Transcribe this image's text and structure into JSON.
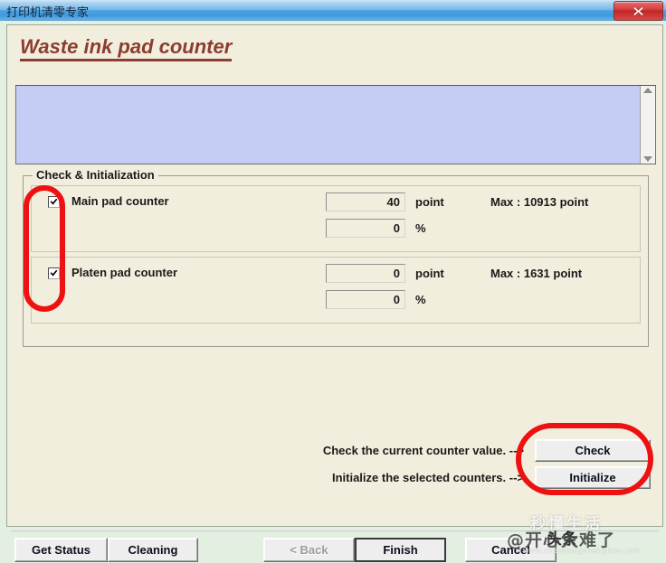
{
  "window": {
    "title": "打印机清零专家",
    "close_icon": "close-x-icon"
  },
  "page": {
    "heading": "Waste ink pad counter",
    "log_text": ""
  },
  "group": {
    "legend": "Check & Initialization",
    "rows": [
      {
        "label": "Main pad counter",
        "checked": true,
        "point_value": "40",
        "point_unit": "point",
        "percent_value": "0",
        "percent_unit": "%",
        "max_label": "Max : 10913 point"
      },
      {
        "label": "Platen pad counter",
        "checked": true,
        "point_value": "0",
        "point_unit": "point",
        "percent_value": "0",
        "percent_unit": "%",
        "max_label": "Max : 1631 point"
      }
    ]
  },
  "actions": [
    {
      "text": "Check the current counter value. -->",
      "button": "Check"
    },
    {
      "text": "Initialize the selected counters. -->",
      "button": "Initialize"
    }
  ],
  "bottom_buttons": {
    "get_status": "Get Status",
    "cleaning": "Cleaning",
    "back": "< Back",
    "finish": "Finish",
    "cancel": "Cancel"
  },
  "watermark": {
    "top": "秒懂生活",
    "badge": "头条",
    "mid": "@开心大难了",
    "url": "www.miaodongshenghuo.com"
  },
  "colors": {
    "accent": "#8c3c30",
    "annotation": "#ee1111",
    "panel": "#f2eedd",
    "window": "#e2efe1",
    "log": "#c6cdf4",
    "titlebar": "#4fa3e0"
  }
}
